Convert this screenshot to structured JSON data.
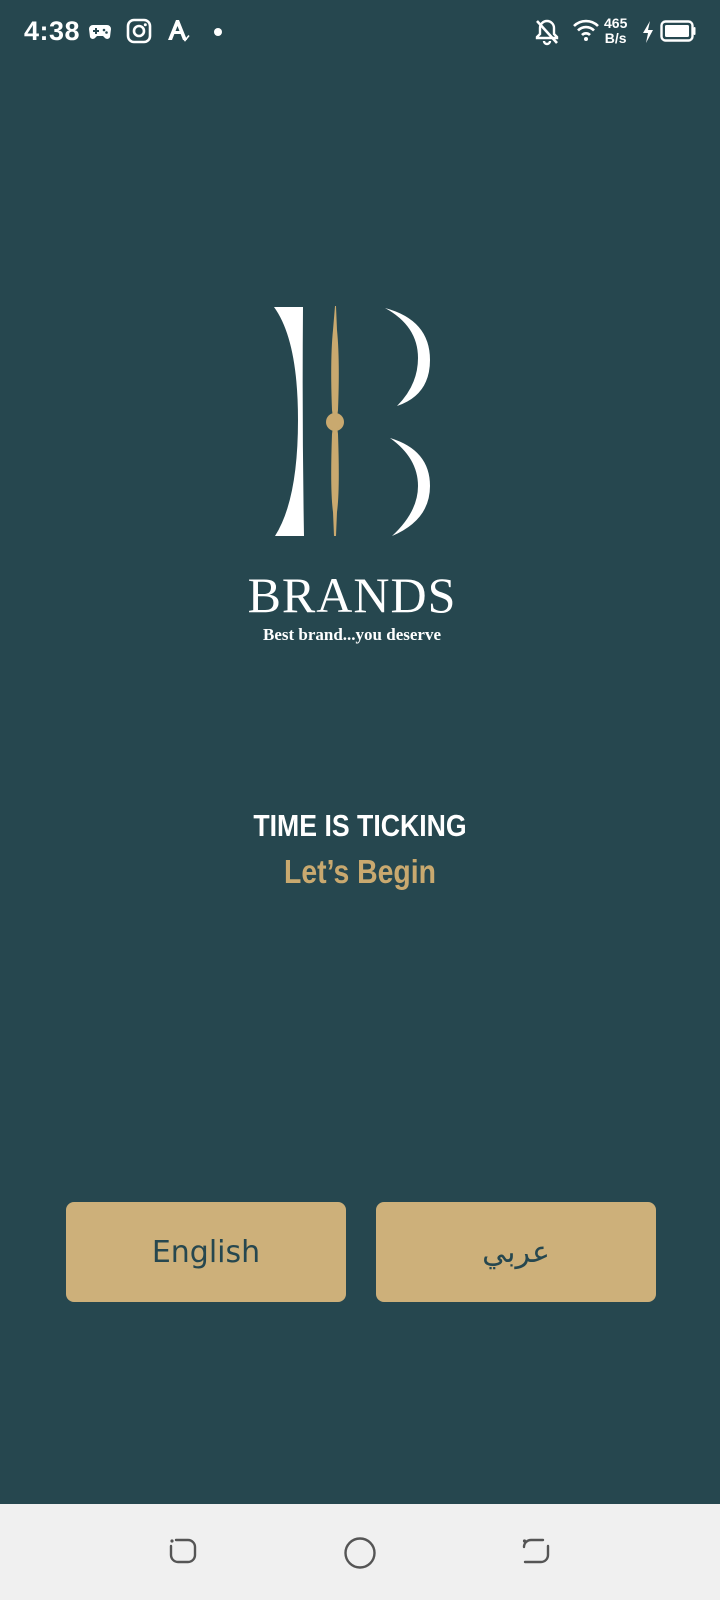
{
  "status_bar": {
    "time": "4:38",
    "net_speed_value": "465",
    "net_speed_unit": "B/s",
    "icons": [
      "gamepad-icon",
      "instagram-icon",
      "translate-icon",
      "dot-icon",
      "bell-off-icon",
      "wifi-icon",
      "charging-bolt-icon",
      "battery-icon"
    ]
  },
  "logo": {
    "name": "BRANDS",
    "tagline": "Best brand...you deserve"
  },
  "hero": {
    "line1": "TIME IS TICKING",
    "line2": "Let’s Begin"
  },
  "language_buttons": {
    "english_label": "English",
    "arabic_label": "عربي"
  },
  "nav_bar": {
    "icons": [
      "back-icon",
      "home-icon",
      "recents-icon"
    ]
  },
  "colors": {
    "background": "#26474F",
    "gold": "#C9A96F",
    "button": "#CDB07A",
    "text_light": "#FFFFFF",
    "nav_background": "#F0F0F0"
  }
}
